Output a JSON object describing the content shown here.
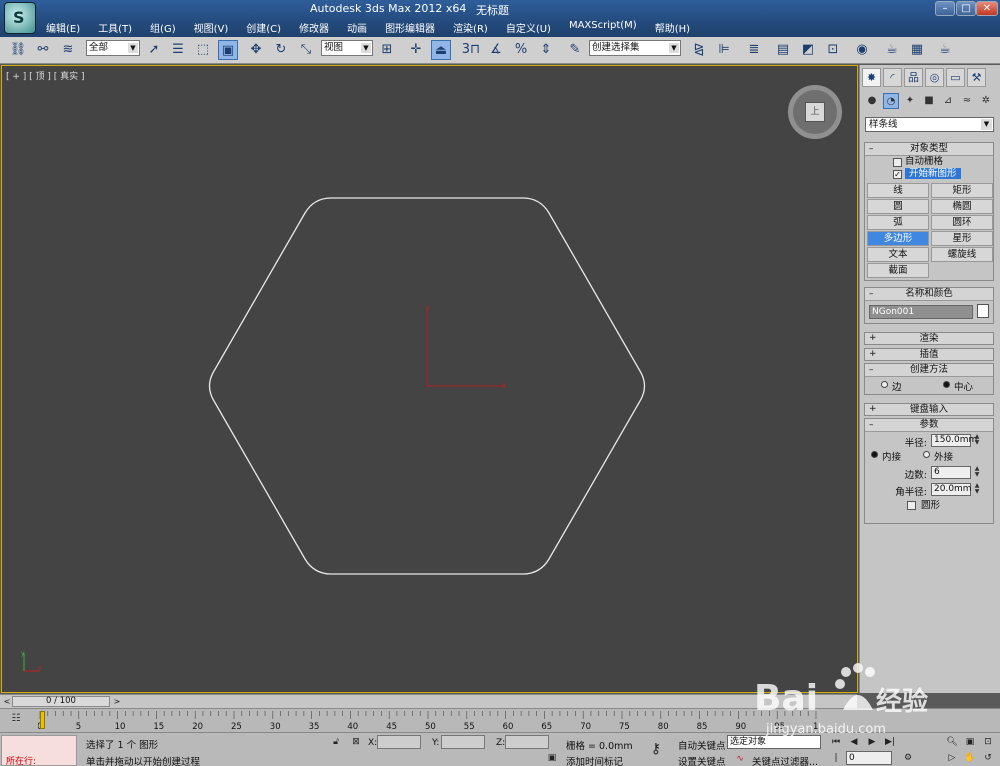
{
  "window": {
    "title": "Autodesk 3ds Max  2012 x64",
    "file": "无标题"
  },
  "menu": [
    "编辑(E)",
    "工具(T)",
    "组(G)",
    "视图(V)",
    "创建(C)",
    "修改器",
    "动画",
    "图形编辑器",
    "渲染(R)",
    "自定义(U)",
    "MAXScript(M)",
    "帮助(H)"
  ],
  "toolbar": {
    "selection_filter": "全部",
    "reference_coord": "视图",
    "named_selection": "创建选择集"
  },
  "viewport": {
    "label": "[ + ] [ 顶 ] [ 真实 ]",
    "viewcube_face": "上",
    "frame": "#d0b000"
  },
  "command_panel": {
    "category": "样条线",
    "object_type": {
      "title": "对象类型",
      "auto_grid": "自动栅格",
      "start_new_shape": "开始新图形",
      "start_new_shape_checked": true,
      "buttons": [
        "线",
        "矩形",
        "圆",
        "椭圆",
        "弧",
        "圆环",
        "多边形",
        "星形",
        "文本",
        "螺旋线",
        "截面"
      ],
      "selected": "多边形"
    },
    "name_color": {
      "title": "名称和颜色",
      "name": "NGon001",
      "color": "#ffffff"
    },
    "rollouts_collapsed": [
      "渲染",
      "插值"
    ],
    "creation_method": {
      "title": "创建方法",
      "edge": "边",
      "center": "中心",
      "selected": "中心"
    },
    "keyboard_entry": "键盘输入",
    "parameters": {
      "title": "参数",
      "radius_label": "半径:",
      "radius": "150.0mm",
      "inscribed": "内接",
      "circumscribed": "外接",
      "selected": "内接",
      "sides_label": "边数:",
      "sides": "6",
      "corner_radius_label": "角半径:",
      "corner_radius": "20.0mm",
      "circular": "圆形"
    }
  },
  "timeline": {
    "slider": "0 / 100",
    "ticks": [
      "0",
      "5",
      "10",
      "15",
      "20",
      "25",
      "30",
      "35",
      "40",
      "45",
      "50",
      "55",
      "60",
      "65",
      "70",
      "75",
      "80",
      "85",
      "90",
      "95",
      "100"
    ]
  },
  "status": {
    "maxscript_label": "所在行:",
    "line1": "选择了 1 个 图形",
    "line2": "单击并拖动以开始创建过程",
    "x_label": "X:",
    "y_label": "Y:",
    "z_label": "Z:",
    "grid": "栅格 = 0.0mm",
    "add_time_tag": "添加时间标记",
    "auto_key": "自动关键点",
    "set_key": "设置关键点",
    "selection_set": "选定对象",
    "key_filters": "关键点过滤器...",
    "frame": "0"
  },
  "watermark": "jingyan.baidu.com"
}
